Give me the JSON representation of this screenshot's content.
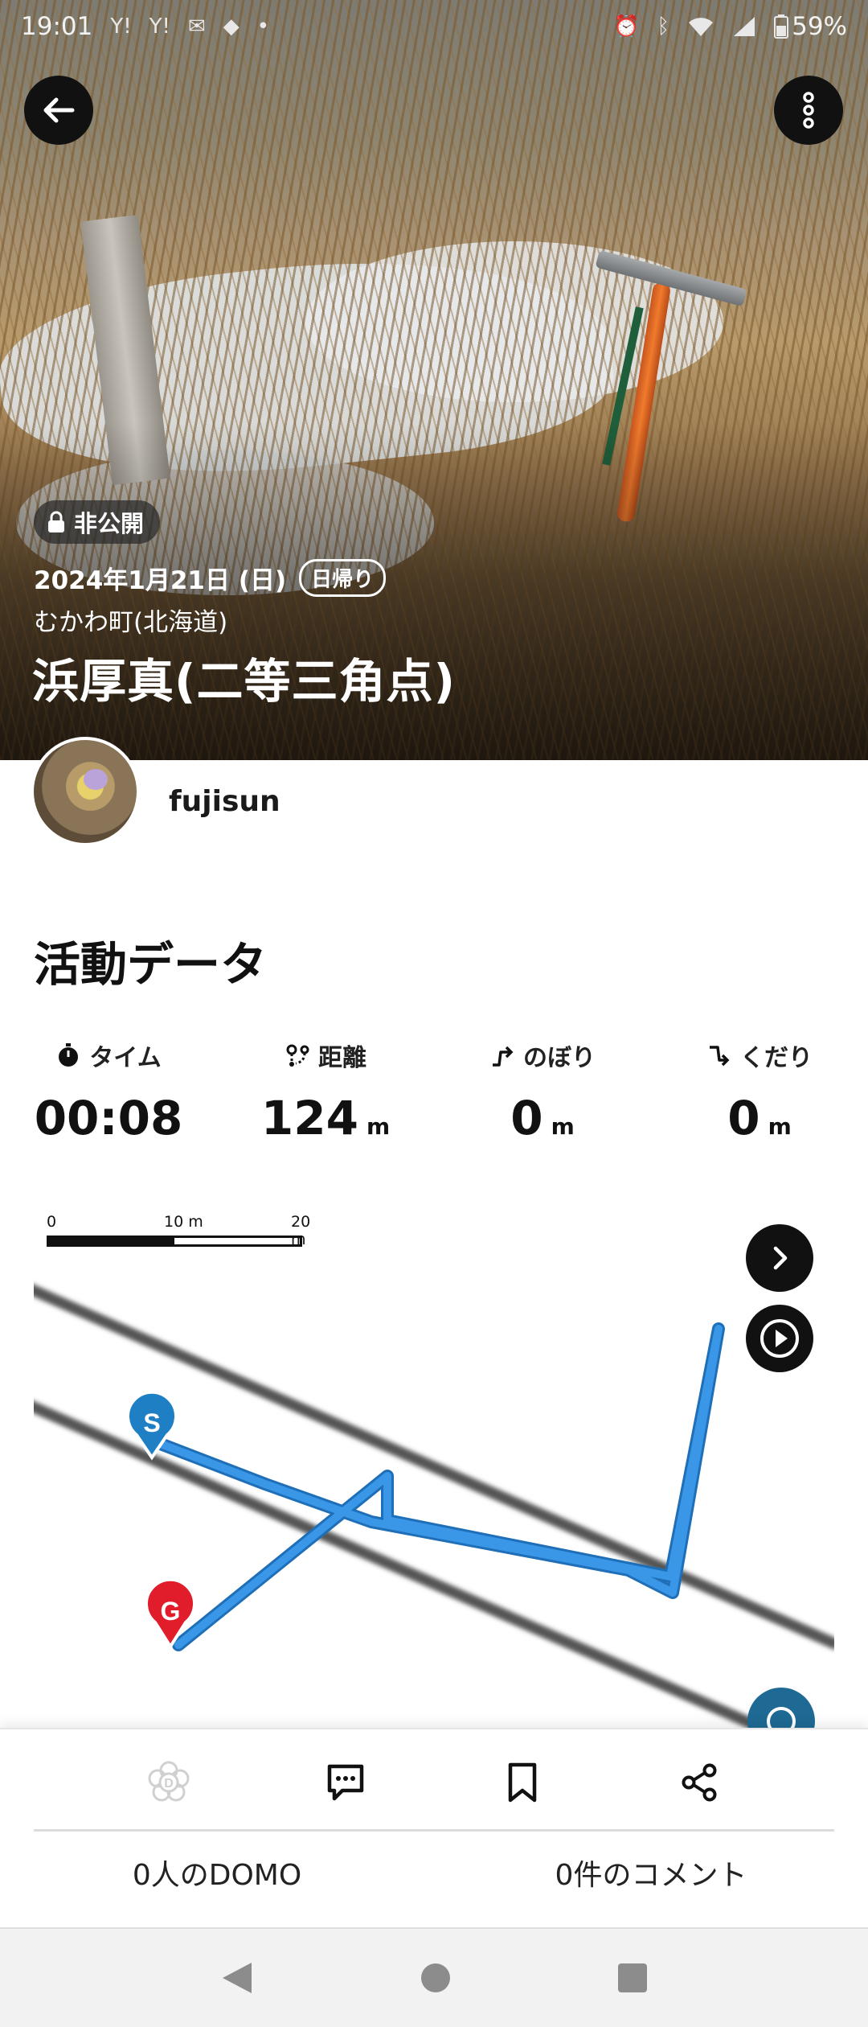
{
  "status_bar": {
    "time": "19:01",
    "notif_icons": [
      "yahoo-icon",
      "yahoo-icon",
      "mail-icon",
      "vpn-icon",
      "dot-icon"
    ],
    "system_icons": [
      "alarm-icon",
      "bluetooth-icon",
      "wifi-icon",
      "signal-icon",
      "battery-icon"
    ],
    "battery": "59%"
  },
  "hero": {
    "privacy_label": "非公開",
    "date": "2024年1月21日 (日)",
    "trip_type": "日帰り",
    "location": "むかわ町(北海道)",
    "title": "浜厚真(二等三角点)"
  },
  "user": {
    "name": "fujisun"
  },
  "activity": {
    "section_title": "活動データ",
    "stats": [
      {
        "label": "タイム",
        "icon": "stopwatch-icon",
        "value": "00:08",
        "unit": ""
      },
      {
        "label": "距離",
        "icon": "route-icon",
        "value": "124",
        "unit": "m"
      },
      {
        "label": "のぼり",
        "icon": "ascent-icon",
        "value": "0",
        "unit": "m"
      },
      {
        "label": "くだり",
        "icon": "descent-icon",
        "value": "0",
        "unit": "m"
      }
    ]
  },
  "map": {
    "scale_labels": [
      "0",
      "10 m",
      "20 m"
    ],
    "start_marker": "S",
    "goal_marker": "G",
    "track_color": "#3a96e6"
  },
  "actions": {
    "domo_count": "0人のDOMO",
    "comment_count": "0件のコメント"
  },
  "colors": {
    "accent_blue": "#1f7fc4",
    "goal_red": "#e11d2b",
    "track_blue": "#3a96e6"
  }
}
